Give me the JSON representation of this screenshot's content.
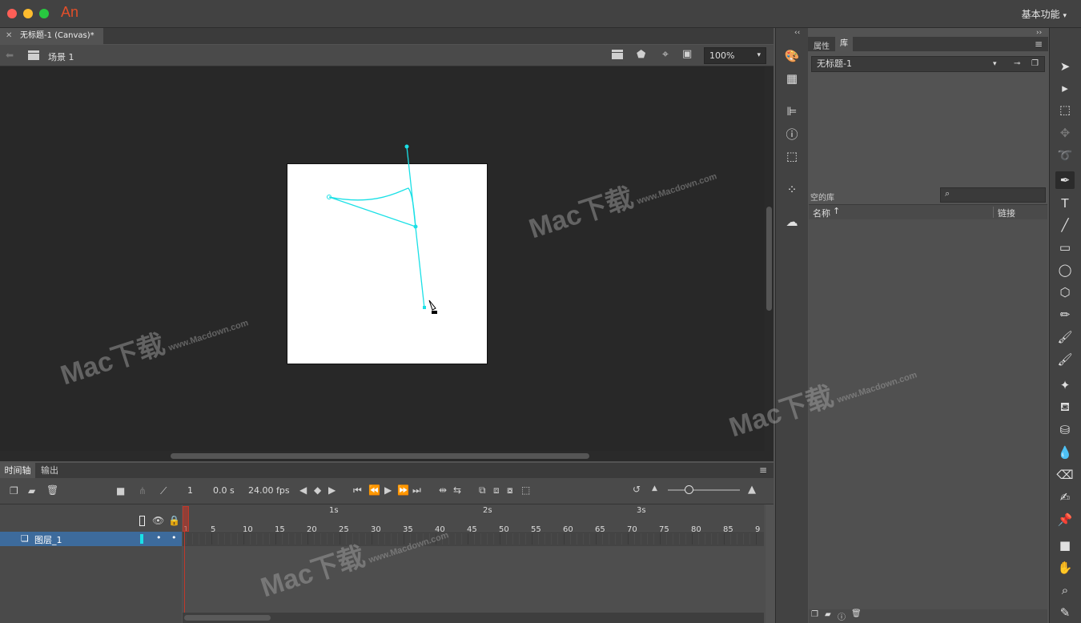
{
  "app": {
    "logo": "An",
    "workspace": "基本功能"
  },
  "document": {
    "tab_label": "无标题-1 (Canvas)*"
  },
  "editbar": {
    "scene": "场景 1",
    "zoom": "100%"
  },
  "timeline": {
    "tabs": [
      "时间轴",
      "输出"
    ],
    "current_frame": "1",
    "time": "0.0 s",
    "fps": "24.00 fps",
    "seconds": [
      "1s",
      "2s",
      "3s"
    ],
    "frame_numbers": [
      "1",
      "5",
      "10",
      "15",
      "20",
      "25",
      "30",
      "35",
      "40",
      "45",
      "50",
      "55",
      "60",
      "65",
      "70",
      "75",
      "80",
      "85",
      "9"
    ],
    "layer_name": "图层_1"
  },
  "library": {
    "tabs": [
      "属性",
      "库"
    ],
    "document": "无标题-1",
    "status": "空的库",
    "col_name": "名称",
    "col_link": "链接"
  },
  "watermark": {
    "brand": "Mac下载",
    "url": "www.Macdown.com"
  },
  "colors": {
    "accent": "#1ae0e6",
    "selection": "#3d6b9c",
    "playhead": "#c0392b"
  }
}
